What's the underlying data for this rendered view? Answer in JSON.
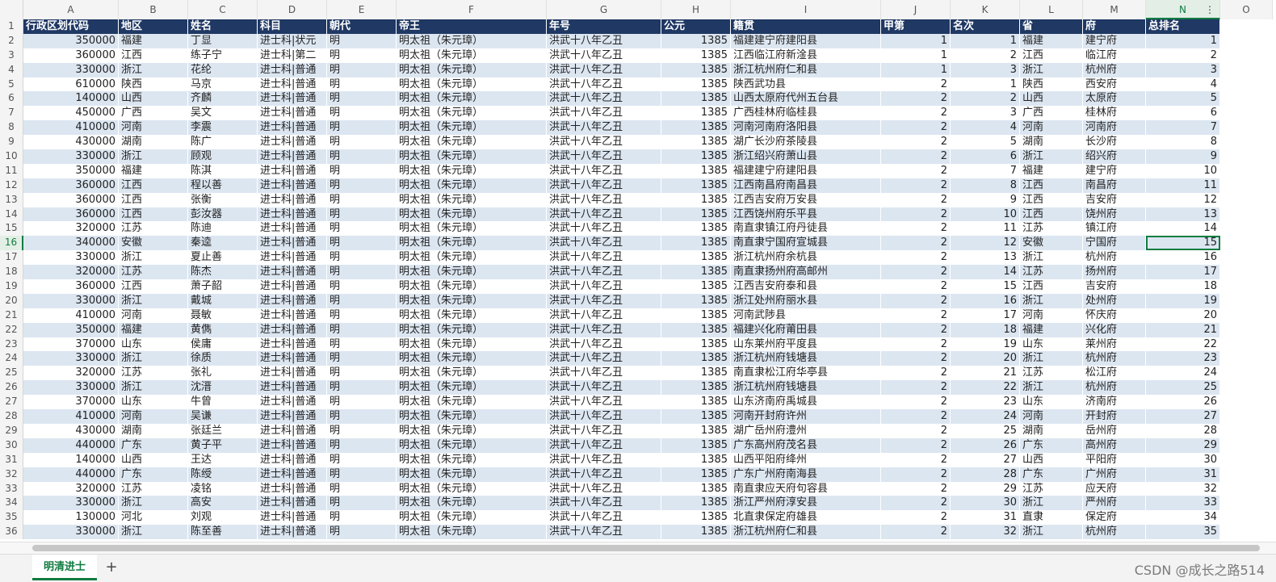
{
  "columns": [
    {
      "letter": "A",
      "width": 118
    },
    {
      "letter": "B",
      "width": 86
    },
    {
      "letter": "C",
      "width": 86
    },
    {
      "letter": "D",
      "width": 86
    },
    {
      "letter": "E",
      "width": 86
    },
    {
      "letter": "F",
      "width": 186
    },
    {
      "letter": "G",
      "width": 142
    },
    {
      "letter": "H",
      "width": 86
    },
    {
      "letter": "I",
      "width": 186
    },
    {
      "letter": "J",
      "width": 86
    },
    {
      "letter": "K",
      "width": 86
    },
    {
      "letter": "L",
      "width": 78
    },
    {
      "letter": "M",
      "width": 78
    },
    {
      "letter": "N",
      "width": 92
    },
    {
      "letter": "O",
      "width": 65
    }
  ],
  "header_row": [
    "行政区划代码",
    "地区",
    "姓名",
    "科目",
    "朝代",
    "帝王",
    "年号",
    "公元",
    "籍贯",
    "甲第",
    "名次",
    "省",
    "府",
    "总排名"
  ],
  "numeric_cols": [
    0,
    7,
    9,
    10,
    13
  ],
  "selected_cell": {
    "row": 16,
    "col": 13
  },
  "rows": [
    [
      "350000",
      "福建",
      "丁显",
      "进士科|状元",
      "明",
      "明太祖（朱元璋）",
      "洪武十八年乙丑",
      "1385",
      "福建建宁府建阳县",
      "1",
      "1",
      "福建",
      "建宁府",
      "1"
    ],
    [
      "360000",
      "江西",
      "练子宁",
      "进士科|第二",
      "明",
      "明太祖（朱元璋）",
      "洪武十八年乙丑",
      "1385",
      "江西临江府新淦县",
      "1",
      "2",
      "江西",
      "临江府",
      "2"
    ],
    [
      "330000",
      "浙江",
      "花纶",
      "进士科|普通",
      "明",
      "明太祖（朱元璋）",
      "洪武十八年乙丑",
      "1385",
      "浙江杭州府仁和县",
      "1",
      "3",
      "浙江",
      "杭州府",
      "3"
    ],
    [
      "610000",
      "陕西",
      "马京",
      "进士科|普通",
      "明",
      "明太祖（朱元璋）",
      "洪武十八年乙丑",
      "1385",
      "陕西武功县",
      "2",
      "1",
      "陕西",
      "西安府",
      "4"
    ],
    [
      "140000",
      "山西",
      "齐麟",
      "进士科|普通",
      "明",
      "明太祖（朱元璋）",
      "洪武十八年乙丑",
      "1385",
      "山西太原府代州五台县",
      "2",
      "2",
      "山西",
      "太原府",
      "5"
    ],
    [
      "450000",
      "广西",
      "吴文",
      "进士科|普通",
      "明",
      "明太祖（朱元璋）",
      "洪武十八年乙丑",
      "1385",
      "广西桂林府临桂县",
      "2",
      "3",
      "广西",
      "桂林府",
      "6"
    ],
    [
      "410000",
      "河南",
      "李震",
      "进士科|普通",
      "明",
      "明太祖（朱元璋）",
      "洪武十八年乙丑",
      "1385",
      "河南河南府洛阳县",
      "2",
      "4",
      "河南",
      "河南府",
      "7"
    ],
    [
      "430000",
      "湖南",
      "陈广",
      "进士科|普通",
      "明",
      "明太祖（朱元璋）",
      "洪武十八年乙丑",
      "1385",
      "湖广长沙府茶陵县",
      "2",
      "5",
      "湖南",
      "长沙府",
      "8"
    ],
    [
      "330000",
      "浙江",
      "顾观",
      "进士科|普通",
      "明",
      "明太祖（朱元璋）",
      "洪武十八年乙丑",
      "1385",
      "浙江绍兴府萧山县",
      "2",
      "6",
      "浙江",
      "绍兴府",
      "9"
    ],
    [
      "350000",
      "福建",
      "陈淇",
      "进士科|普通",
      "明",
      "明太祖（朱元璋）",
      "洪武十八年乙丑",
      "1385",
      "福建建宁府建阳县",
      "2",
      "7",
      "福建",
      "建宁府",
      "10"
    ],
    [
      "360000",
      "江西",
      "程以善",
      "进士科|普通",
      "明",
      "明太祖（朱元璋）",
      "洪武十八年乙丑",
      "1385",
      "江西南昌府南昌县",
      "2",
      "8",
      "江西",
      "南昌府",
      "11"
    ],
    [
      "360000",
      "江西",
      "张衡",
      "进士科|普通",
      "明",
      "明太祖（朱元璋）",
      "洪武十八年乙丑",
      "1385",
      "江西吉安府万安县",
      "2",
      "9",
      "江西",
      "吉安府",
      "12"
    ],
    [
      "360000",
      "江西",
      "彭汝器",
      "进士科|普通",
      "明",
      "明太祖（朱元璋）",
      "洪武十八年乙丑",
      "1385",
      "江西饶州府乐平县",
      "2",
      "10",
      "江西",
      "饶州府",
      "13"
    ],
    [
      "320000",
      "江苏",
      "陈迪",
      "进士科|普通",
      "明",
      "明太祖（朱元璋）",
      "洪武十八年乙丑",
      "1385",
      "南直隶镇江府丹徒县",
      "2",
      "11",
      "江苏",
      "镇江府",
      "14"
    ],
    [
      "340000",
      "安徽",
      "秦逵",
      "进士科|普通",
      "明",
      "明太祖（朱元璋）",
      "洪武十八年乙丑",
      "1385",
      "南直隶宁国府宣城县",
      "2",
      "12",
      "安徽",
      "宁国府",
      "15"
    ],
    [
      "330000",
      "浙江",
      "夏止善",
      "进士科|普通",
      "明",
      "明太祖（朱元璋）",
      "洪武十八年乙丑",
      "1385",
      "浙江杭州府余杭县",
      "2",
      "13",
      "浙江",
      "杭州府",
      "16"
    ],
    [
      "320000",
      "江苏",
      "陈杰",
      "进士科|普通",
      "明",
      "明太祖（朱元璋）",
      "洪武十八年乙丑",
      "1385",
      "南直隶扬州府高邮州",
      "2",
      "14",
      "江苏",
      "扬州府",
      "17"
    ],
    [
      "360000",
      "江西",
      "萧子韶",
      "进士科|普通",
      "明",
      "明太祖（朱元璋）",
      "洪武十八年乙丑",
      "1385",
      "江西吉安府泰和县",
      "2",
      "15",
      "江西",
      "吉安府",
      "18"
    ],
    [
      "330000",
      "浙江",
      "戴城",
      "进士科|普通",
      "明",
      "明太祖（朱元璋）",
      "洪武十八年乙丑",
      "1385",
      "浙江处州府丽水县",
      "2",
      "16",
      "浙江",
      "处州府",
      "19"
    ],
    [
      "410000",
      "河南",
      "聂敏",
      "进士科|普通",
      "明",
      "明太祖（朱元璋）",
      "洪武十八年乙丑",
      "1385",
      "河南武陟县",
      "2",
      "17",
      "河南",
      "怀庆府",
      "20"
    ],
    [
      "350000",
      "福建",
      "黄儁",
      "进士科|普通",
      "明",
      "明太祖（朱元璋）",
      "洪武十八年乙丑",
      "1385",
      "福建兴化府莆田县",
      "2",
      "18",
      "福建",
      "兴化府",
      "21"
    ],
    [
      "370000",
      "山东",
      "侯庸",
      "进士科|普通",
      "明",
      "明太祖（朱元璋）",
      "洪武十八年乙丑",
      "1385",
      "山东莱州府平度县",
      "2",
      "19",
      "山东",
      "莱州府",
      "22"
    ],
    [
      "330000",
      "浙江",
      "徐质",
      "进士科|普通",
      "明",
      "明太祖（朱元璋）",
      "洪武十八年乙丑",
      "1385",
      "浙江杭州府钱塘县",
      "2",
      "20",
      "浙江",
      "杭州府",
      "23"
    ],
    [
      "320000",
      "江苏",
      "张礼",
      "进士科|普通",
      "明",
      "明太祖（朱元璋）",
      "洪武十八年乙丑",
      "1385",
      "南直隶松江府华亭县",
      "2",
      "21",
      "江苏",
      "松江府",
      "24"
    ],
    [
      "330000",
      "浙江",
      "沈溍",
      "进士科|普通",
      "明",
      "明太祖（朱元璋）",
      "洪武十八年乙丑",
      "1385",
      "浙江杭州府钱塘县",
      "2",
      "22",
      "浙江",
      "杭州府",
      "25"
    ],
    [
      "370000",
      "山东",
      "牛曾",
      "进士科|普通",
      "明",
      "明太祖（朱元璋）",
      "洪武十八年乙丑",
      "1385",
      "山东济南府禹城县",
      "2",
      "23",
      "山东",
      "济南府",
      "26"
    ],
    [
      "410000",
      "河南",
      "吴谦",
      "进士科|普通",
      "明",
      "明太祖（朱元璋）",
      "洪武十八年乙丑",
      "1385",
      "河南开封府许州",
      "2",
      "24",
      "河南",
      "开封府",
      "27"
    ],
    [
      "430000",
      "湖南",
      "张廷兰",
      "进士科|普通",
      "明",
      "明太祖（朱元璋）",
      "洪武十八年乙丑",
      "1385",
      "湖广岳州府澧州",
      "2",
      "25",
      "湖南",
      "岳州府",
      "28"
    ],
    [
      "440000",
      "广东",
      "黄子平",
      "进士科|普通",
      "明",
      "明太祖（朱元璋）",
      "洪武十八年乙丑",
      "1385",
      "广东高州府茂名县",
      "2",
      "26",
      "广东",
      "高州府",
      "29"
    ],
    [
      "140000",
      "山西",
      "王达",
      "进士科|普通",
      "明",
      "明太祖（朱元璋）",
      "洪武十八年乙丑",
      "1385",
      "山西平阳府绛州",
      "2",
      "27",
      "山西",
      "平阳府",
      "30"
    ],
    [
      "440000",
      "广东",
      "陈绶",
      "进士科|普通",
      "明",
      "明太祖（朱元璋）",
      "洪武十八年乙丑",
      "1385",
      "广东广州府南海县",
      "2",
      "28",
      "广东",
      "广州府",
      "31"
    ],
    [
      "320000",
      "江苏",
      "凌铭",
      "进士科|普通",
      "明",
      "明太祖（朱元璋）",
      "洪武十八年乙丑",
      "1385",
      "南直隶应天府句容县",
      "2",
      "29",
      "江苏",
      "应天府",
      "32"
    ],
    [
      "330000",
      "浙江",
      "高安",
      "进士科|普通",
      "明",
      "明太祖（朱元璋）",
      "洪武十八年乙丑",
      "1385",
      "浙江严州府淳安县",
      "2",
      "30",
      "浙江",
      "严州府",
      "33"
    ],
    [
      "130000",
      "河北",
      "刘观",
      "进士科|普通",
      "明",
      "明太祖（朱元璋）",
      "洪武十八年乙丑",
      "1385",
      "北直隶保定府雄县",
      "2",
      "31",
      "直隶",
      "保定府",
      "34"
    ],
    [
      "330000",
      "浙江",
      "陈至善",
      "进士科|普通",
      "明",
      "明太祖（朱元璋）",
      "洪武十八年乙丑",
      "1385",
      "浙江杭州府仁和县",
      "2",
      "32",
      "浙江",
      "杭州府",
      "35"
    ]
  ],
  "tabs": {
    "active": "明清进士",
    "add": "+"
  },
  "watermark": "CSDN @成长之路514",
  "colors": {
    "header_bg": "#1f3864",
    "band": "#dce6f1",
    "accent": "#107c41"
  }
}
